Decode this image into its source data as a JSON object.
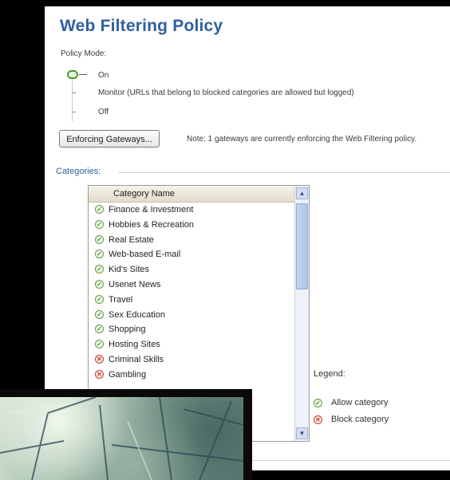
{
  "page": {
    "title": "Web Filtering Policy"
  },
  "policy_mode": {
    "label": "Policy Mode:",
    "options": [
      "On",
      "Monitor (URLs that belong to blocked categories are allowed but logged)",
      "Off"
    ],
    "selected": "On"
  },
  "enforcing": {
    "button_label": "Enforcing Gateways...",
    "note": "Note: 1 gateways are currently enforcing the Web Filtering policy."
  },
  "categories": {
    "label": "Categories:",
    "column_header": "Category Name",
    "items": [
      {
        "name": "Finance & Investment",
        "status": "allow",
        "icon": "allow-category-icon"
      },
      {
        "name": "Hobbies & Recreation",
        "status": "allow",
        "icon": "allow-category-icon"
      },
      {
        "name": "Real Estate",
        "status": "allow",
        "icon": "allow-category-icon"
      },
      {
        "name": "Web-based E-mail",
        "status": "allow",
        "icon": "allow-category-icon"
      },
      {
        "name": "Kid's Sites",
        "status": "allow",
        "icon": "allow-category-icon"
      },
      {
        "name": "Usenet News",
        "status": "allow",
        "icon": "allow-category-icon"
      },
      {
        "name": "Travel",
        "status": "allow",
        "icon": "allow-category-icon"
      },
      {
        "name": "Sex Education",
        "status": "allow",
        "icon": "allow-category-icon"
      },
      {
        "name": "Shopping",
        "status": "allow",
        "icon": "allow-category-icon"
      },
      {
        "name": "Hosting Sites",
        "status": "allow",
        "icon": "allow-category-icon"
      },
      {
        "name": "Criminal Skills",
        "status": "block",
        "icon": "block-category-icon"
      },
      {
        "name": "Gambling",
        "status": "block",
        "icon": "block-category-icon"
      }
    ]
  },
  "legend": {
    "title": "Legend:",
    "allow_label": "Allow category",
    "block_label": "Block category"
  },
  "colors": {
    "title": "#2f5f9f",
    "allow": "#4a8a2a",
    "block": "#c43a2a"
  }
}
